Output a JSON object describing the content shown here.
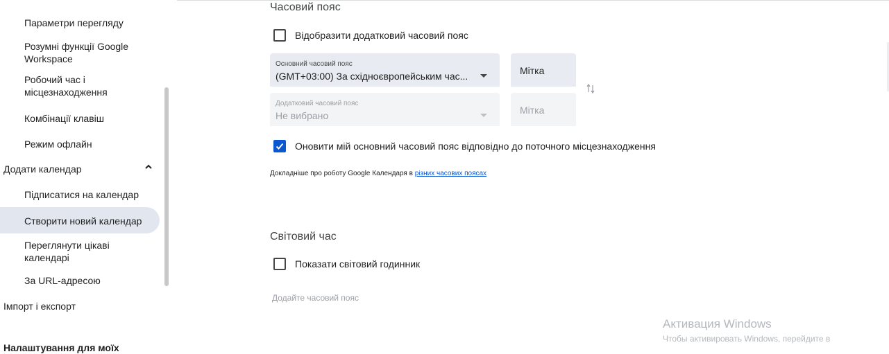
{
  "sidebar": {
    "items": [
      {
        "label": "Параметри перегляду"
      },
      {
        "label": "Розумні функції Google Workspace"
      },
      {
        "label": "Робочий час і місцезнаходження"
      },
      {
        "label": "Комбінації клавіш"
      },
      {
        "label": "Режим офлайн"
      }
    ],
    "add_calendar": {
      "label": "Додати календар"
    },
    "add_items": [
      {
        "label": "Підписатися на календар"
      },
      {
        "label": "Створити новий календар"
      },
      {
        "label": "Переглянути цікаві календарі"
      },
      {
        "label": "За URL-адресою"
      }
    ],
    "import_export": {
      "label": "Імпорт і експорт"
    },
    "my_settings": {
      "label": "Налаштування для моїх"
    }
  },
  "timezone": {
    "title": "Часовий пояс",
    "show_secondary_label": "Відобразити додатковий часовий пояс",
    "show_secondary_checked": false,
    "primary": {
      "caption": "Основний часовий пояс",
      "value": "(GMT+03:00) За східноєвропейським час..."
    },
    "primary_tag": "Мітка",
    "secondary": {
      "caption": "Додатковий часовий пояс",
      "value": "Не вибрано"
    },
    "secondary_tag": "Мітка",
    "update_label": "Оновити мій основний часовий пояс відповідно до поточного місцезнаходження",
    "update_checked": true,
    "note_prefix": "Докладніше про роботу Google Календаря в ",
    "note_link": "різних часових поясах"
  },
  "world_clock": {
    "title": "Світовий час",
    "show_label": "Показати світовий годинник",
    "show_checked": false,
    "add_hint": "Додайте часовий пояс"
  },
  "watermark": {
    "title": "Активация Windows",
    "subtitle": "Чтобы активировать Windows, перейдите в"
  },
  "colors": {
    "accent": "#0b57d0",
    "active_bg": "#e2e7ef",
    "field_bg": "#e8ebf1"
  }
}
